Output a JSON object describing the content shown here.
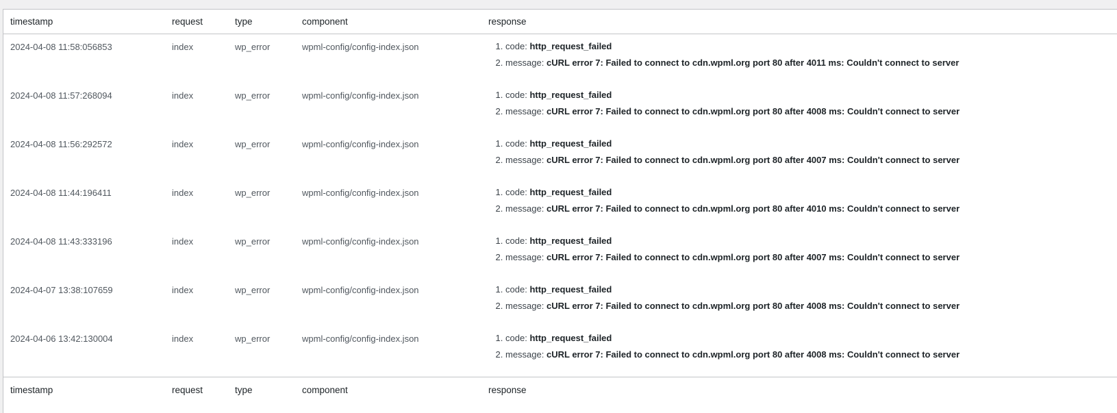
{
  "columns": {
    "timestamp": "timestamp",
    "request": "request",
    "type": "type",
    "component": "component",
    "response": "response"
  },
  "rows": [
    {
      "timestamp": "2024-04-08 11:58:056853",
      "request": "index",
      "type": "wp_error",
      "component": "wpml-config/config-index.json",
      "code_label": "code:",
      "code": "http_request_failed",
      "message_label": "message:",
      "message": "cURL error 7: Failed to connect to cdn.wpml.org port 80 after 4011 ms: Couldn't connect to server"
    },
    {
      "timestamp": "2024-04-08 11:57:268094",
      "request": "index",
      "type": "wp_error",
      "component": "wpml-config/config-index.json",
      "code_label": "code:",
      "code": "http_request_failed",
      "message_label": "message:",
      "message": "cURL error 7: Failed to connect to cdn.wpml.org port 80 after 4008 ms: Couldn't connect to server"
    },
    {
      "timestamp": "2024-04-08 11:56:292572",
      "request": "index",
      "type": "wp_error",
      "component": "wpml-config/config-index.json",
      "code_label": "code:",
      "code": "http_request_failed",
      "message_label": "message:",
      "message": "cURL error 7: Failed to connect to cdn.wpml.org port 80 after 4007 ms: Couldn't connect to server"
    },
    {
      "timestamp": "2024-04-08 11:44:196411",
      "request": "index",
      "type": "wp_error",
      "component": "wpml-config/config-index.json",
      "code_label": "code:",
      "code": "http_request_failed",
      "message_label": "message:",
      "message": "cURL error 7: Failed to connect to cdn.wpml.org port 80 after 4010 ms: Couldn't connect to server"
    },
    {
      "timestamp": "2024-04-08 11:43:333196",
      "request": "index",
      "type": "wp_error",
      "component": "wpml-config/config-index.json",
      "code_label": "code:",
      "code": "http_request_failed",
      "message_label": "message:",
      "message": "cURL error 7: Failed to connect to cdn.wpml.org port 80 after 4007 ms: Couldn't connect to server"
    },
    {
      "timestamp": "2024-04-07 13:38:107659",
      "request": "index",
      "type": "wp_error",
      "component": "wpml-config/config-index.json",
      "code_label": "code:",
      "code": "http_request_failed",
      "message_label": "message:",
      "message": "cURL error 7: Failed to connect to cdn.wpml.org port 80 after 4008 ms: Couldn't connect to server"
    },
    {
      "timestamp": "2024-04-06 13:42:130004",
      "request": "index",
      "type": "wp_error",
      "component": "wpml-config/config-index.json",
      "code_label": "code:",
      "code": "http_request_failed",
      "message_label": "message:",
      "message": "cURL error 7: Failed to connect to cdn.wpml.org port 80 after 4008 ms: Couldn't connect to server"
    }
  ],
  "colors": {
    "background": "#f0f0f1",
    "panel": "#ffffff",
    "border": "#c3c4c7",
    "text": "#3c434a",
    "strong": "#1d2327"
  }
}
